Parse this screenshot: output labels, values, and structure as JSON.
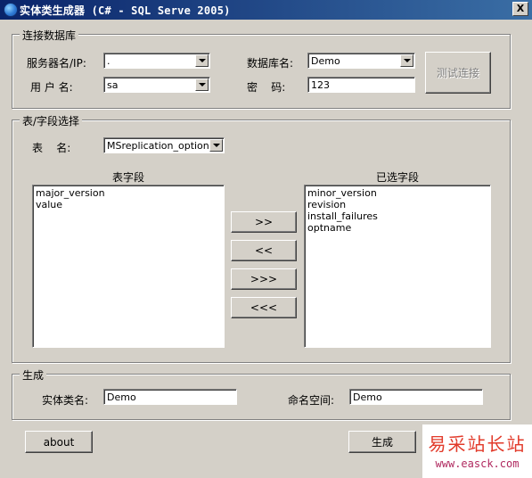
{
  "window": {
    "title": "实体类生成器 (C# - SQL Serve 2005)",
    "close_glyph": "X"
  },
  "connection": {
    "group_title": "连接数据库",
    "server_label": "服务器名/IP:",
    "server_value": ".",
    "user_label": "用 户 名:",
    "user_value": "sa",
    "db_label": "数据库名:",
    "db_value": "Demo",
    "password_label": "密    码:",
    "password_value": "123",
    "test_button": "测试连接"
  },
  "table_select": {
    "group_title": "表/字段选择",
    "table_label": "表    名:",
    "table_value": "MSreplication_options",
    "fields_header": "表字段",
    "selected_header": "已选字段",
    "fields": [
      "major_version",
      "value"
    ],
    "selected_fields": [
      "minor_version",
      "revision",
      "install_failures",
      "optname"
    ],
    "buttons": {
      "add": ">>",
      "remove": "<<",
      "add_all": ">>>",
      "remove_all": "<<<"
    }
  },
  "generate": {
    "group_title": "生成",
    "class_label": "实体类名:",
    "class_value": "Demo",
    "namespace_label": "命名空间:",
    "namespace_value": "Demo"
  },
  "footer": {
    "about_button": "about",
    "generate_button": "生成"
  },
  "watermark": {
    "line1": "易采站长站",
    "line2": "www.easck.com"
  }
}
